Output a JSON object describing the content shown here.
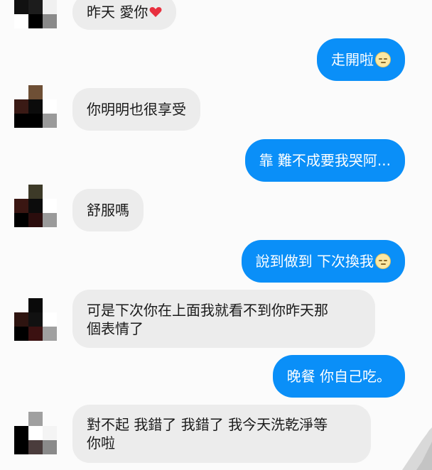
{
  "colors": {
    "incoming_bubble": "#ececec",
    "outgoing_bubble": "#0a8ff8",
    "background": "#fbfbfb"
  },
  "messages": [
    {
      "side": "in",
      "text": "昨天 愛你",
      "icon": "heart-icon"
    },
    {
      "side": "out",
      "text": "走開啦",
      "icon": "neutral-face-emoji-icon"
    },
    {
      "side": "in",
      "text": "你明明也很享受"
    },
    {
      "side": "out",
      "text": "靠 難不成要我哭阿..."
    },
    {
      "side": "in",
      "text": "舒服嗎"
    },
    {
      "side": "out",
      "text": "說到做到 下次換我",
      "icon": "neutral-face-emoji-icon"
    },
    {
      "side": "in",
      "text": "可是下次你在上面我就看不到你昨天那\n個表情了"
    },
    {
      "side": "out",
      "text": "晚餐 你自己吃。"
    },
    {
      "side": "in",
      "text": "對不起 我錯了 我錯了 我今天洗乾淨等\n你啦"
    }
  ]
}
